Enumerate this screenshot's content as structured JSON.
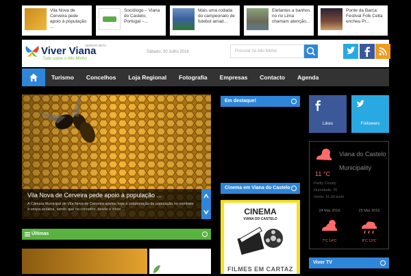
{
  "ticker": [
    {
      "title": "Vila Nova de Cerveira pede apoio à população ...",
      "icon": "honeycomb-thumb"
    },
    {
      "title": "Sociólogo – Viana do Castelo, Portugal –...",
      "icon": "logo-thumb"
    },
    {
      "title": "Mais uma rodada do campeonato de futebol amad...",
      "icon": "football-thumb"
    },
    {
      "title": "Elefantes a banhos no rio Lima chamam atenção...",
      "icon": "elephants-thumb"
    },
    {
      "title": "Ponte da Barca: Festival Folk Celta encheu Pr...",
      "icon": "festival-thumb"
    }
  ],
  "header": {
    "logo_title": "Viver Viana",
    "logo_sub": "Tudo sobre o Alto Minho",
    "logo_beta": "VERSÃO BETA",
    "date": "Sábado, 30 Julho 2016",
    "search_placeholder": "Procurar no Alto Minho"
  },
  "nav": {
    "items": [
      "Turismo",
      "Concelhos",
      "Loja Regional",
      "Fotografia",
      "Empresas",
      "Contacto",
      "Agenda"
    ]
  },
  "slider": {
    "title": "Vila Nova de Cerveira pede apoio à população ...",
    "text": "A Câmara Municipal de Vila Nova de Cerveira apelou hoje à colaboração da população no combate à vespa asiática, sendo que no concelho, desde o início ..."
  },
  "sections": {
    "ultimas": "Últimas",
    "destaque": "Em destaque!",
    "cinema": "Cinema em Viana do Castelo",
    "vivertv": "Viver TV"
  },
  "social": {
    "likes": "Likes",
    "followers": "Followers"
  },
  "weather": {
    "city": "Viana do Castelo Municipality",
    "temp": "11 °C",
    "condition": "Partly Cloudy",
    "humidity": "Humidade: 76",
    "wind": "Vento: 16.09 km/h",
    "day1": {
      "date": "24 Mar 2016",
      "range": "7°C   14°C"
    },
    "day2": {
      "date": "25 Mar 2016",
      "range": "8°C   13°C"
    }
  },
  "cinema": {
    "title": "CINEMA",
    "subtitle": "VIANA DO CASTELO",
    "bottom": "FILMES EM CARTAZ"
  },
  "colors": {
    "accent": "#2f86d8",
    "green": "#58b33f",
    "facebook": "#3b5998",
    "twitter": "#29a9e1",
    "rss": "#f39a1e"
  }
}
